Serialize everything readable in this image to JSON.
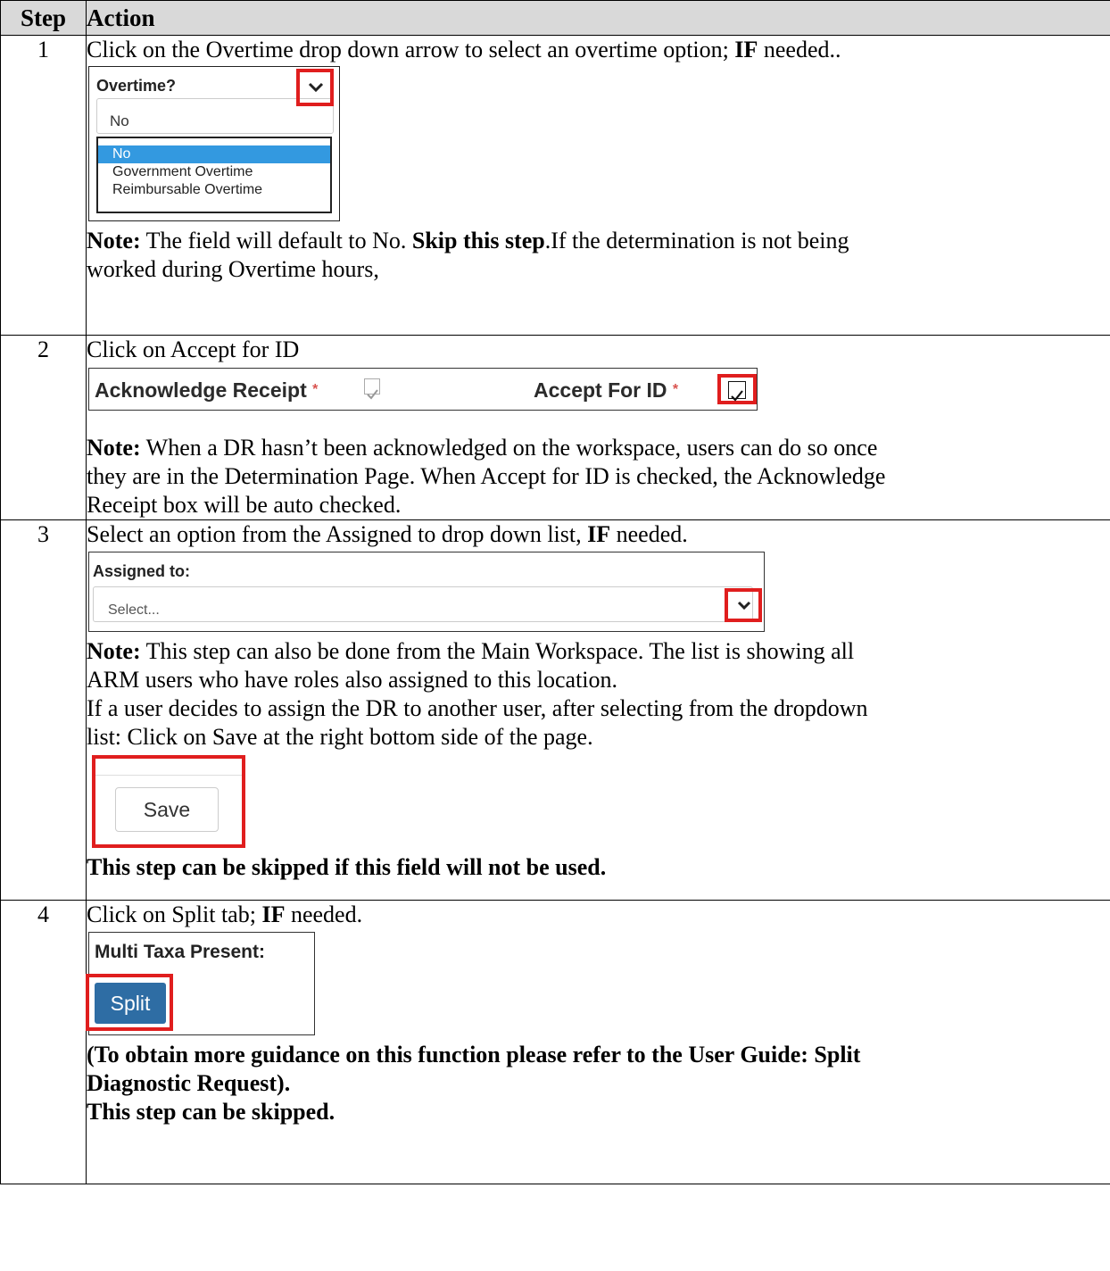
{
  "header": {
    "step": "Step",
    "action": "Action"
  },
  "steps": [
    {
      "num": "1",
      "intro_pre": "Click on the Overtime drop down arrow to select an overtime option; ",
      "intro_bold": "IF",
      "intro_post": " needed..",
      "widget": {
        "title": "Overtime?",
        "value": "No",
        "options": [
          "No",
          "Government Overtime",
          "Reimbursable Overtime"
        ]
      },
      "note_label": "Note:",
      "note_text1": " The field will default to No.  ",
      "note_bold": "Skip this step",
      "note_text2": ".If the determination is not being",
      "note_line2": "worked during Overtime hours,"
    },
    {
      "num": "2",
      "intro": "Click on Accept for ID",
      "widget": {
        "ack_label": "Acknowledge Receipt",
        "accept_label": "Accept For ID",
        "star": "*"
      },
      "note_label": "Note:",
      "note_line1": " When a DR hasn’t been acknowledged on the workspace, users can do so once",
      "note_line2": "they are in the Determination Page. When Accept for ID is checked, the Acknowledge",
      "note_line3": "Receipt box will be auto checked."
    },
    {
      "num": "3",
      "intro_pre": "Select an option from the Assigned to drop down list, ",
      "intro_bold": "IF",
      "intro_post": " needed.",
      "widget": {
        "title": "Assigned to:",
        "placeholder": "Select..."
      },
      "note_label": "Note:",
      "note_line1": " This step can also be done from the Main Workspace. The list is showing all",
      "note_line2": "ARM users who have roles also assigned to this location.",
      "note_line3": "If a user decides to assign the DR to another user, after selecting from the dropdown",
      "note_line4": "list: Click on Save at the right bottom side of the page.",
      "save_label": "Save",
      "footer": "This step can be skipped if this field will not be used."
    },
    {
      "num": "4",
      "intro_pre": "Click on Split tab; ",
      "intro_bold": "IF",
      "intro_post": " needed.",
      "widget": {
        "title": "Multi Taxa Present:",
        "button": "Split"
      },
      "bold_line1": "(To obtain more guidance on this function please refer to the User Guide: Split",
      "bold_line2": "Diagnostic Request).",
      "bold_line3": "This step can be skipped."
    }
  ],
  "colors": {
    "highlight": "#e01e1e",
    "selected_option": "#3399e0",
    "split_button": "#2e6da4",
    "header_bg": "#d9d9d9"
  }
}
